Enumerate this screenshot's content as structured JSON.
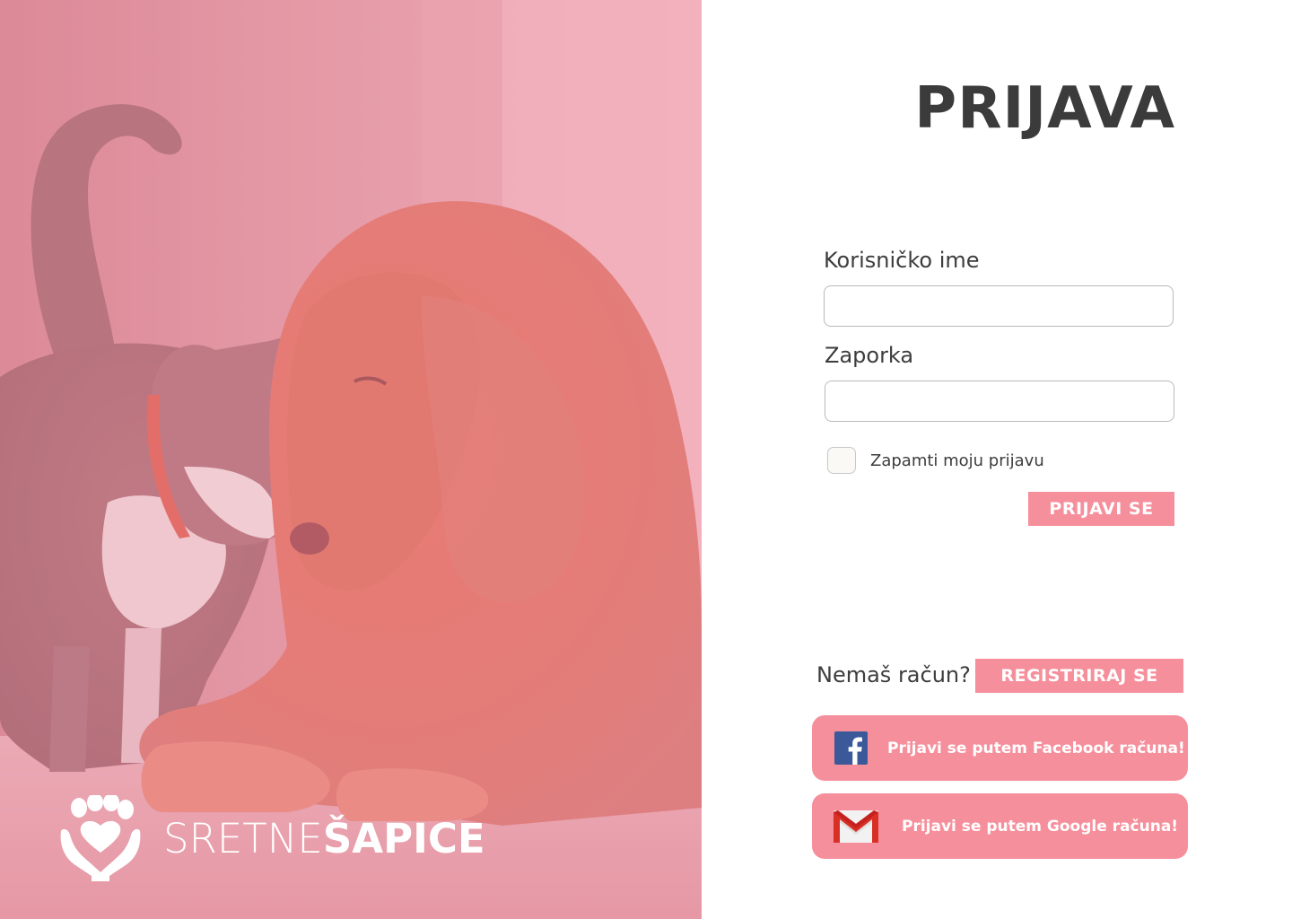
{
  "hero": {
    "brand_light": "SRETNE",
    "brand_bold": "ŠAPICE",
    "overlay_color": "#f08fa0",
    "logo_icon": "paw-heart-hands-icon"
  },
  "login": {
    "title": "PRIJAVA",
    "username_label": "Korisničko ime",
    "username_value": "",
    "password_label": "Zaporka",
    "password_value": "",
    "remember_label": "Zapamti moju prijavu",
    "remember_checked": false,
    "submit_label": "PRIJAVI SE"
  },
  "register": {
    "prompt": "Nemaš račun?",
    "button_label": "REGISTRIRAJ SE"
  },
  "social": {
    "facebook_label": "Prijavi se putem Facebook računa!",
    "facebook_icon": "facebook-icon",
    "google_label": "Prijavi se putem Google računa!",
    "google_icon": "gmail-icon"
  },
  "colors": {
    "accent": "#f68f9c",
    "title_text": "#3b3b3b",
    "body_text": "#3d3d3d"
  }
}
